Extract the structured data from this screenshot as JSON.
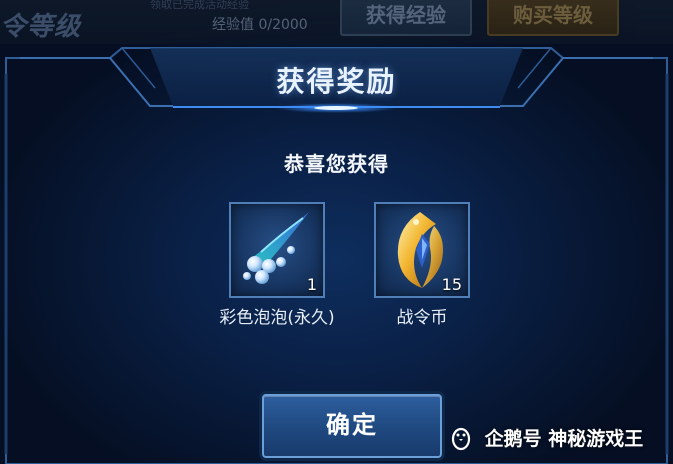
{
  "background_bar": {
    "level_title": "令等级",
    "tiny_text": "领取已完成活动经验",
    "exp_text": "经验值 0/2000",
    "get_exp_button": "获得经验",
    "buy_level_button": "购买等级"
  },
  "dialog": {
    "title": "获得奖励",
    "congrats": "恭喜您获得",
    "rewards": [
      {
        "name": "彩色泡泡(永久)",
        "quantity": "1",
        "icon": "bubble-effect-icon"
      },
      {
        "name": "战令币",
        "quantity": "15",
        "icon": "battle-pass-coin-icon"
      }
    ],
    "confirm_button": "确定"
  },
  "watermark": {
    "text": "企鹅号 神秘游戏王",
    "icon": "penguin-icon"
  },
  "colors": {
    "panel_bg": "#0a2148",
    "frame_glow": "#3a8cff",
    "button_bg": "#204a82",
    "button_border": "#6a9fd8"
  }
}
